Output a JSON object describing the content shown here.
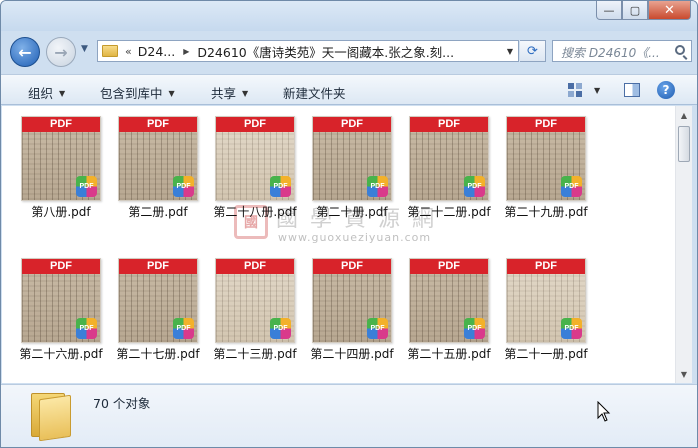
{
  "window": {
    "controls": {
      "minimize": "—",
      "maximize": "▢",
      "close": "✕"
    }
  },
  "navigation": {
    "back_icon": "back-arrow-icon",
    "forward_icon": "forward-arrow-icon",
    "address": {
      "chevron": "«",
      "segments": [
        "D24...",
        "D24610《唐诗类苑》天一阁藏本.张之象.刻..."
      ]
    },
    "search": {
      "placeholder": "搜索 D24610《..."
    }
  },
  "toolbar": {
    "organize": "组织",
    "include_in_library": "包含到库中",
    "share": "共享",
    "new_folder": "新建文件夹"
  },
  "files": [
    {
      "name": "第八册.pdf",
      "thumb_tone": "dark"
    },
    {
      "name": "第二册.pdf",
      "thumb_tone": "dark"
    },
    {
      "name": "第二十八册.pdf",
      "thumb_tone": "light"
    },
    {
      "name": "第二十册.pdf",
      "thumb_tone": "dark"
    },
    {
      "name": "第二十二册.pdf",
      "thumb_tone": "dark"
    },
    {
      "name": "第二十九册.pdf",
      "thumb_tone": "dark"
    },
    {
      "name": "第二十六册.pdf",
      "thumb_tone": "dark"
    },
    {
      "name": "第二十七册.pdf",
      "thumb_tone": "dark"
    },
    {
      "name": "第二十三册.pdf",
      "thumb_tone": "light"
    },
    {
      "name": "第二十四册.pdf",
      "thumb_tone": "dark"
    },
    {
      "name": "第二十五册.pdf",
      "thumb_tone": "dark"
    },
    {
      "name": "第二十一册.pdf",
      "thumb_tone": "light"
    }
  ],
  "thumb_label": "PDF",
  "badge_label": "PDF",
  "watermark": {
    "seal": "國",
    "title": "國學資源網",
    "url": "www.guoxueziyuan.com"
  },
  "details": {
    "count_text": "70 个对象"
  },
  "colors": {
    "pdf_red": "#d8232a",
    "window_frame": "#cfdff0"
  }
}
